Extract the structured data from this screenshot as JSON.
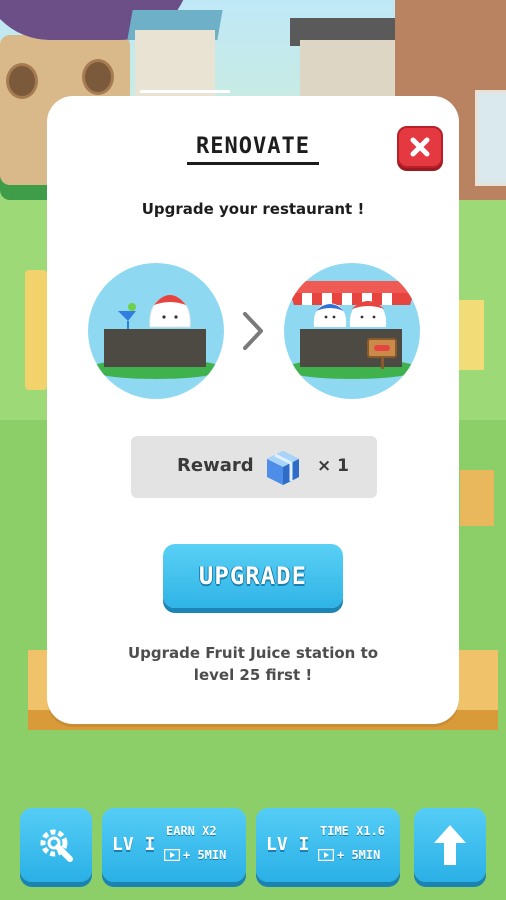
{
  "dialog": {
    "title": "RENOVATE",
    "subtitle": "Upgrade your restaurant !",
    "reward_label": "Reward",
    "reward_count": "× 1",
    "reward_icon": "blue-gift-box-icon",
    "upgrade_label": "UPGRADE",
    "note_line1": "Upgrade Fruit Juice station to",
    "note_line2": "level  25 first !"
  },
  "bottom_bar": {
    "earn": {
      "level": "LV I",
      "stat": "EARN X2",
      "ad_time": "+ 5MIN",
      "ad_icon": "video-ad-icon"
    },
    "time": {
      "level": "LV I",
      "stat": "TIME X1.6",
      "ad_time": "+ 5MIN",
      "ad_icon": "video-ad-icon"
    }
  },
  "colors": {
    "accent_blue": "#2fb4e6",
    "close_red": "#e53941",
    "dialog_bg": "#ffffff",
    "reward_bg": "#e3e3e3"
  }
}
